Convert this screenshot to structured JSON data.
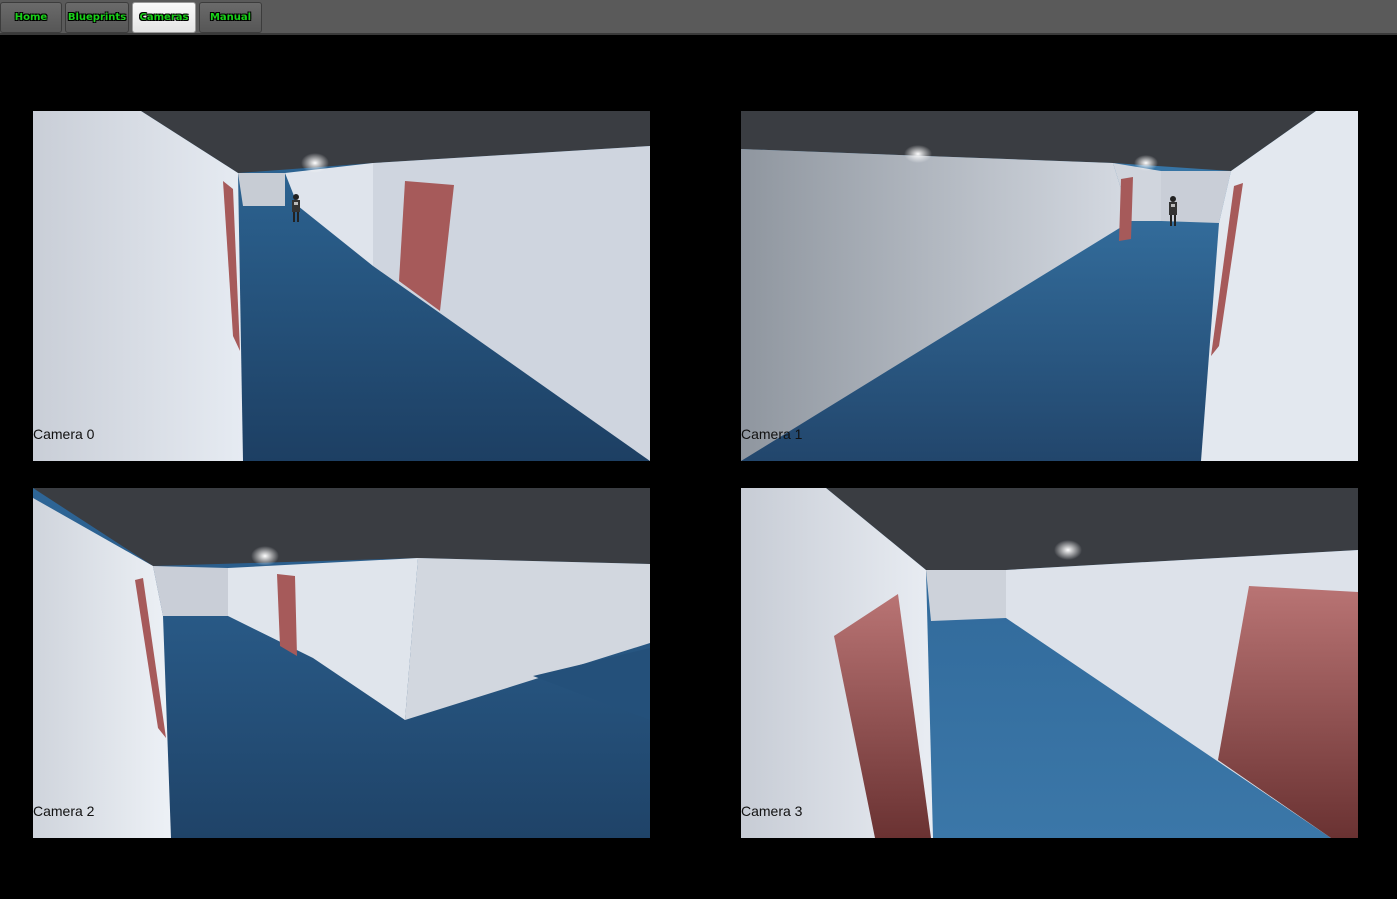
{
  "nav": {
    "tabs": [
      {
        "label": "Home",
        "active": false
      },
      {
        "label": "Blueprints",
        "active": false
      },
      {
        "label": "Cameras",
        "active": true
      },
      {
        "label": "Manual",
        "active": false
      }
    ]
  },
  "cameras": [
    {
      "label": "Camera 0"
    },
    {
      "label": "Camera 1"
    },
    {
      "label": "Camera 2"
    },
    {
      "label": "Camera 3"
    }
  ],
  "colors": {
    "tab_text": "#19d219",
    "floor": "#2b5d8a",
    "wall": "#d8dee8",
    "ceiling": "#3a3d42",
    "door": "#a65a5a"
  }
}
